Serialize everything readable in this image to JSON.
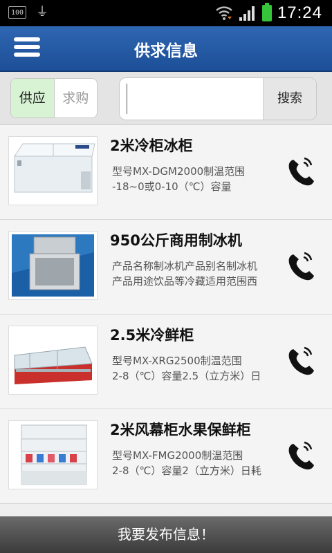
{
  "statusbar": {
    "battery_small": "100",
    "time": "17:24",
    "icons": [
      "usb-icon",
      "wifi-icon",
      "signal-icon",
      "battery-icon"
    ]
  },
  "header": {
    "title": "供求信息",
    "menu_icon": "menu-icon"
  },
  "segment": {
    "supply": "供应",
    "demand": "求购",
    "selected": "供应"
  },
  "search": {
    "value": "",
    "placeholder": "",
    "button": "搜索"
  },
  "items": [
    {
      "title": "2米冷柜冰柜",
      "desc1": "型号MX-DGM2000制温范围",
      "desc2": "-18~0或0-10（℃）容量"
    },
    {
      "title": "950公斤商用制冰机",
      "desc1": "产品名称制冰机产品别名制冰机",
      "desc2": "产品用途饮品等冷藏适用范围西"
    },
    {
      "title": "2.5米冷鲜柜",
      "desc1": "型号MX-XRG2500制温范围",
      "desc2": "2-8（℃）容量2.5（立方米）日"
    },
    {
      "title": "2米风幕柜水果保鲜柜",
      "desc1": "型号MX-FMG2000制温范围",
      "desc2": "2-8（℃）容量2（立方米）日耗"
    }
  ],
  "bottom_button": "我要发布信息！",
  "colors": {
    "header": "#1f5aa5",
    "segment_selected": "#d7f3d3",
    "battery": "#35c43a"
  }
}
